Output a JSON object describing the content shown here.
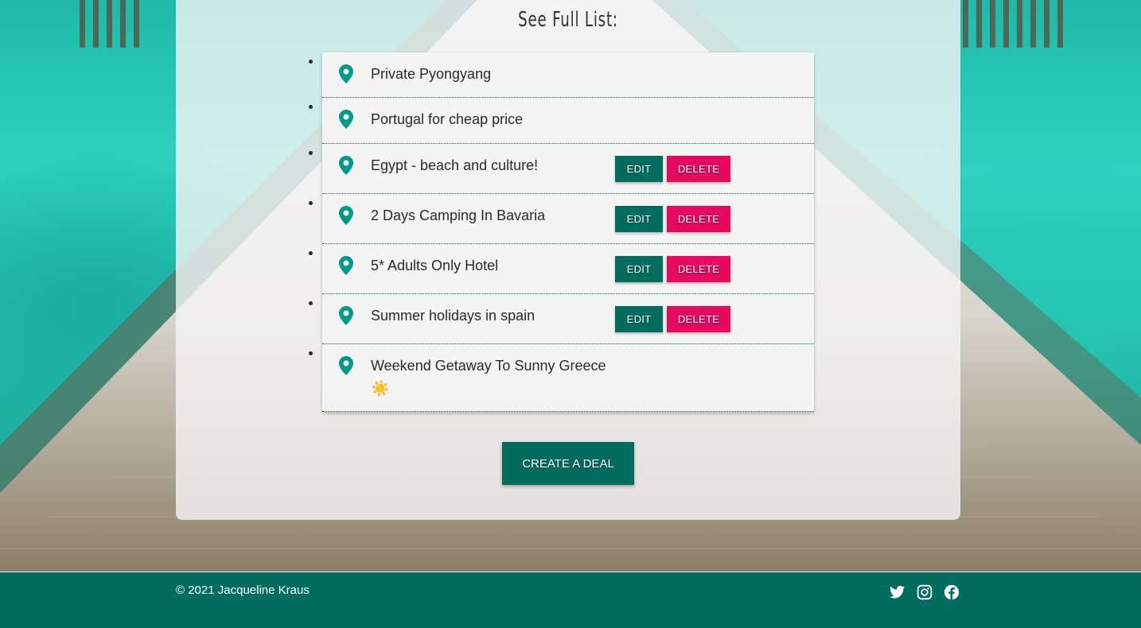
{
  "page": {
    "title": "See Full List:"
  },
  "deals": [
    {
      "title": "Private Pyongyang",
      "editable": false
    },
    {
      "title": "Portugal for cheap price",
      "editable": false
    },
    {
      "title": "Egypt - beach and culture!",
      "editable": true
    },
    {
      "title": "2 Days Camping In Bavaria",
      "editable": true
    },
    {
      "title": "5* Adults Only Hotel",
      "editable": true
    },
    {
      "title": "Summer holidays in spain",
      "editable": true
    },
    {
      "title": "Weekend Getaway To Sunny Greece",
      "emoji": "☀️",
      "editable": false
    }
  ],
  "buttons": {
    "edit_label": "Edit",
    "delete_label": "Delete",
    "create_label": "Create a deal"
  },
  "footer": {
    "copyright": "© 2021 Jacqueline Kraus",
    "social": [
      "twitter-icon",
      "instagram-icon",
      "facebook-icon"
    ]
  },
  "colors": {
    "primary": "#006d5f",
    "danger": "#e5095f",
    "pin": "#009a8c"
  }
}
